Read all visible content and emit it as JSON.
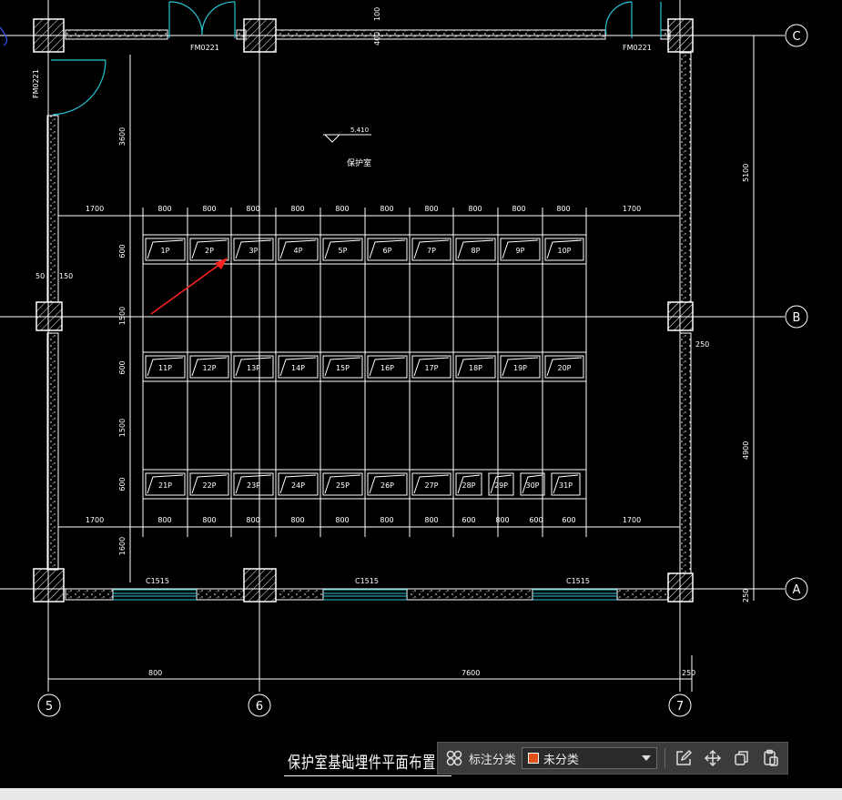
{
  "room_label": "保护室",
  "elevation": "5.410",
  "doors": [
    "FM0221",
    "FM0221",
    "FM0221"
  ],
  "windows": [
    "C1515",
    "C1515",
    "C1515"
  ],
  "grid_rows": [
    "C",
    "B",
    "A"
  ],
  "grid_cols": [
    "5",
    "6",
    "7"
  ],
  "top_dims": [
    "1700",
    "800",
    "800",
    "800",
    "800",
    "800",
    "800",
    "800",
    "800",
    "800",
    "800",
    "1700"
  ],
  "bottom_dims": [
    "1700",
    "800",
    "800",
    "800",
    "800",
    "800",
    "800",
    "800",
    "600",
    "800",
    "600",
    "600",
    "1700"
  ],
  "left_dims": [
    "3600",
    "600",
    "1500",
    "600",
    "1500",
    "600",
    "1600"
  ],
  "right_dims": [
    "5100",
    "250",
    "4900",
    "250"
  ],
  "misc_dims": [
    "50",
    "150",
    "100",
    "400"
  ],
  "bottom_total": [
    "800",
    "7600",
    "250"
  ],
  "row1_panels": [
    "1P",
    "2P",
    "3P",
    "4P",
    "5P",
    "6P",
    "7P",
    "8P",
    "9P",
    "10P"
  ],
  "row2_panels": [
    "11P",
    "12P",
    "13P",
    "14P",
    "15P",
    "16P",
    "17P",
    "18P",
    "19P",
    "20P"
  ],
  "row3_panels": [
    "21P",
    "22P",
    "23P",
    "24P",
    "25P",
    "26P",
    "27P",
    "28P",
    "29P",
    "30P",
    "31P"
  ],
  "drawing_title": "保护室基础埋件平面布置",
  "toolbar": {
    "category_label": "标注分类",
    "category_value": "未分类",
    "accent": "#e0511a"
  },
  "icons": [
    "grid-icon",
    "edit-icon",
    "move-icon",
    "copy-icon",
    "paste-icon"
  ]
}
